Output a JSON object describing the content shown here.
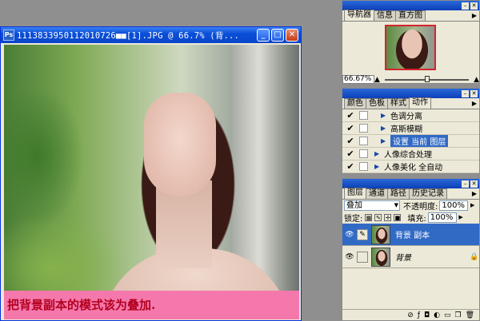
{
  "document": {
    "title": "1113833950112010726■■[1].JPG @ 66.7% (背...",
    "app_icon": "Ps",
    "caption": "把背景副本的模式该为叠加."
  },
  "navigator": {
    "tabs": [
      "导航器",
      "信息",
      "直方图"
    ],
    "zoom": "66.67%",
    "zoom_slider_fraction": 0.5
  },
  "actions": {
    "tabs": [
      "颜色",
      "色板",
      "样式",
      "动作"
    ],
    "items": [
      {
        "label": "色调分离",
        "checked": true,
        "dialog": false,
        "indent": 2,
        "selected": false
      },
      {
        "label": "高斯模糊",
        "checked": true,
        "dialog": true,
        "indent": 2,
        "selected": false
      },
      {
        "label": "设置 当前 图层",
        "checked": true,
        "dialog": false,
        "indent": 2,
        "selected": true
      },
      {
        "label": "人像综合处理",
        "checked": true,
        "dialog": false,
        "indent": 1,
        "selected": false
      },
      {
        "label": "人像美化 全自动",
        "checked": true,
        "dialog": true,
        "indent": 1,
        "selected": false
      }
    ]
  },
  "layers": {
    "tabs": [
      "图层",
      "通道",
      "路径",
      "历史记录"
    ],
    "blend_mode": "叠加",
    "opacity_label": "不透明度:",
    "opacity": "100%",
    "lock_label": "锁定:",
    "fill_label": "填充:",
    "fill": "100%",
    "items": [
      {
        "name": "背景 副本",
        "selected": true,
        "visible": true,
        "locked": false
      },
      {
        "name": "背景",
        "selected": false,
        "visible": true,
        "locked": true
      }
    ]
  },
  "colors": {
    "caption_bg": "#f478ab",
    "caption_text": "#b4001f",
    "selection": "#316ac5",
    "title_bar": "#0a4fd8"
  }
}
